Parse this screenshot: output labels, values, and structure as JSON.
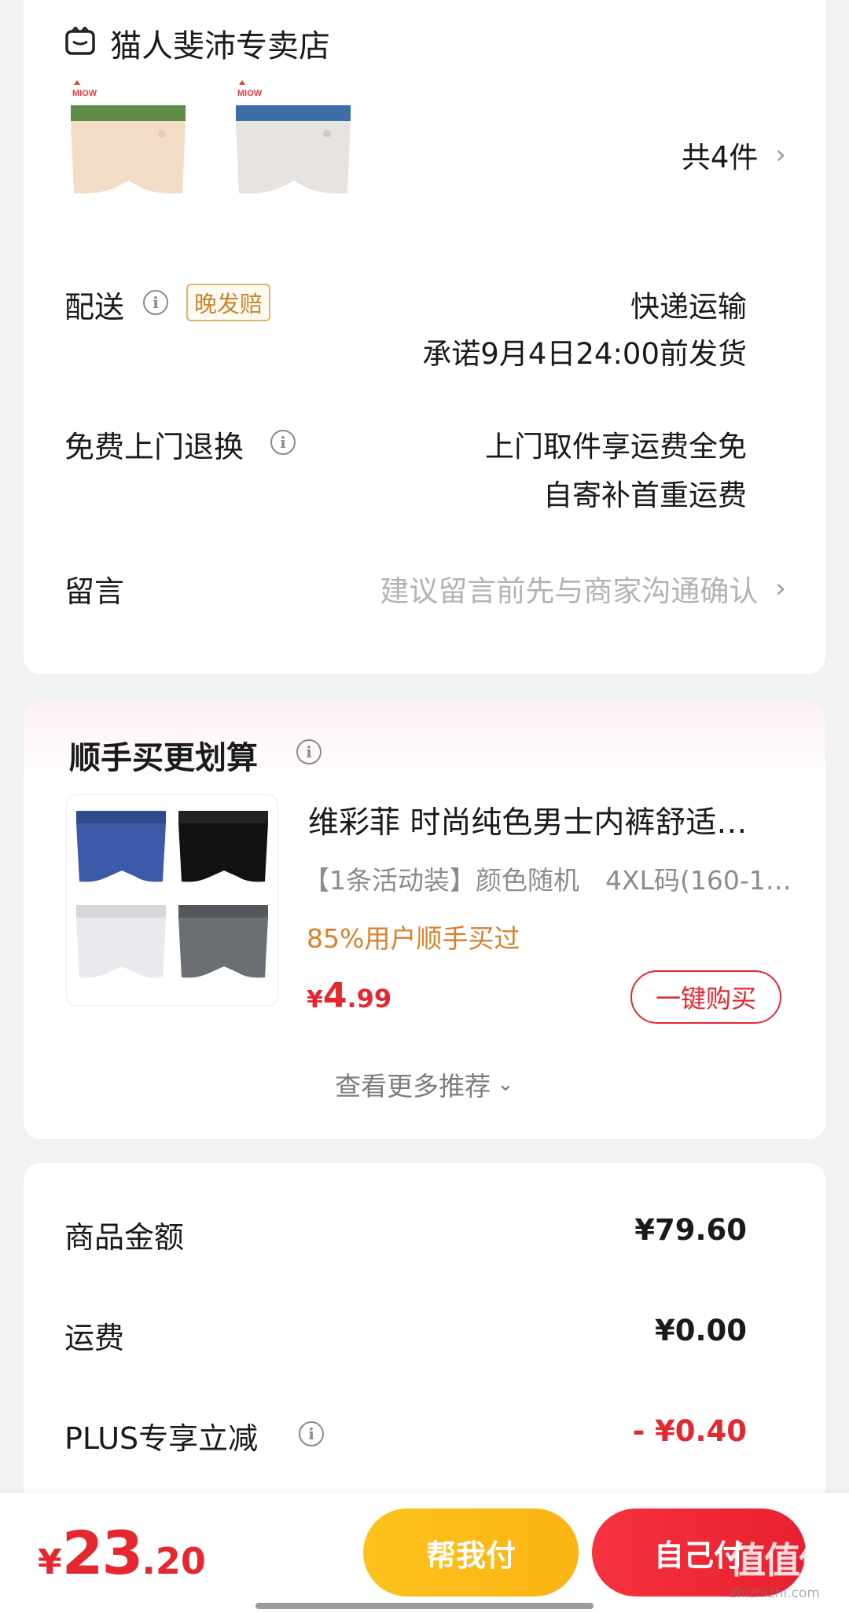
{
  "store": {
    "name": "猫人斐沛专卖店",
    "item_count": "共4件",
    "product_brand_mark": "MIOW",
    "shipping": {
      "label": "配送",
      "badge": "晚发赔",
      "method": "快递运输",
      "promise": "承诺9月4日24:00前发货"
    },
    "returns": {
      "label": "免费上门退换",
      "line1": "上门取件享运费全免",
      "line2": "自寄补首重运费"
    },
    "message": {
      "label": "留言",
      "placeholder": "建议留言前先与商家沟通确认"
    }
  },
  "recommend": {
    "title": "顺手买更划算",
    "product": {
      "title": "维彩菲 时尚纯色男士内裤舒适…",
      "spec": "【1条活动装】颜色随机　4XL码(160-1…",
      "popularity": "85%用户顺手买过",
      "price_symbol": "¥",
      "price_int": "4",
      "price_dec": ".99",
      "buy_label": "一键购买"
    },
    "more_label": "查看更多推荐"
  },
  "summary": {
    "rows": [
      {
        "label": "商品金额",
        "value": "¥79.60"
      },
      {
        "label": "运费",
        "value": "¥0.00"
      },
      {
        "label": "PLUS专享立减",
        "value": "- ¥0.40"
      }
    ]
  },
  "bottom": {
    "currency": "¥",
    "total_int": "23",
    "total_dec": ".20",
    "help_pay_label": "帮我付",
    "self_pay_label": "自己付",
    "watermark_text": "值值值",
    "watermark_url": "zhizhizhi.com"
  },
  "colors": {
    "accent_red": "#e5282f",
    "popularity_orange": "#d9822b",
    "badge_border": "#e2b46b",
    "help_yellow": "#fbbb17"
  }
}
